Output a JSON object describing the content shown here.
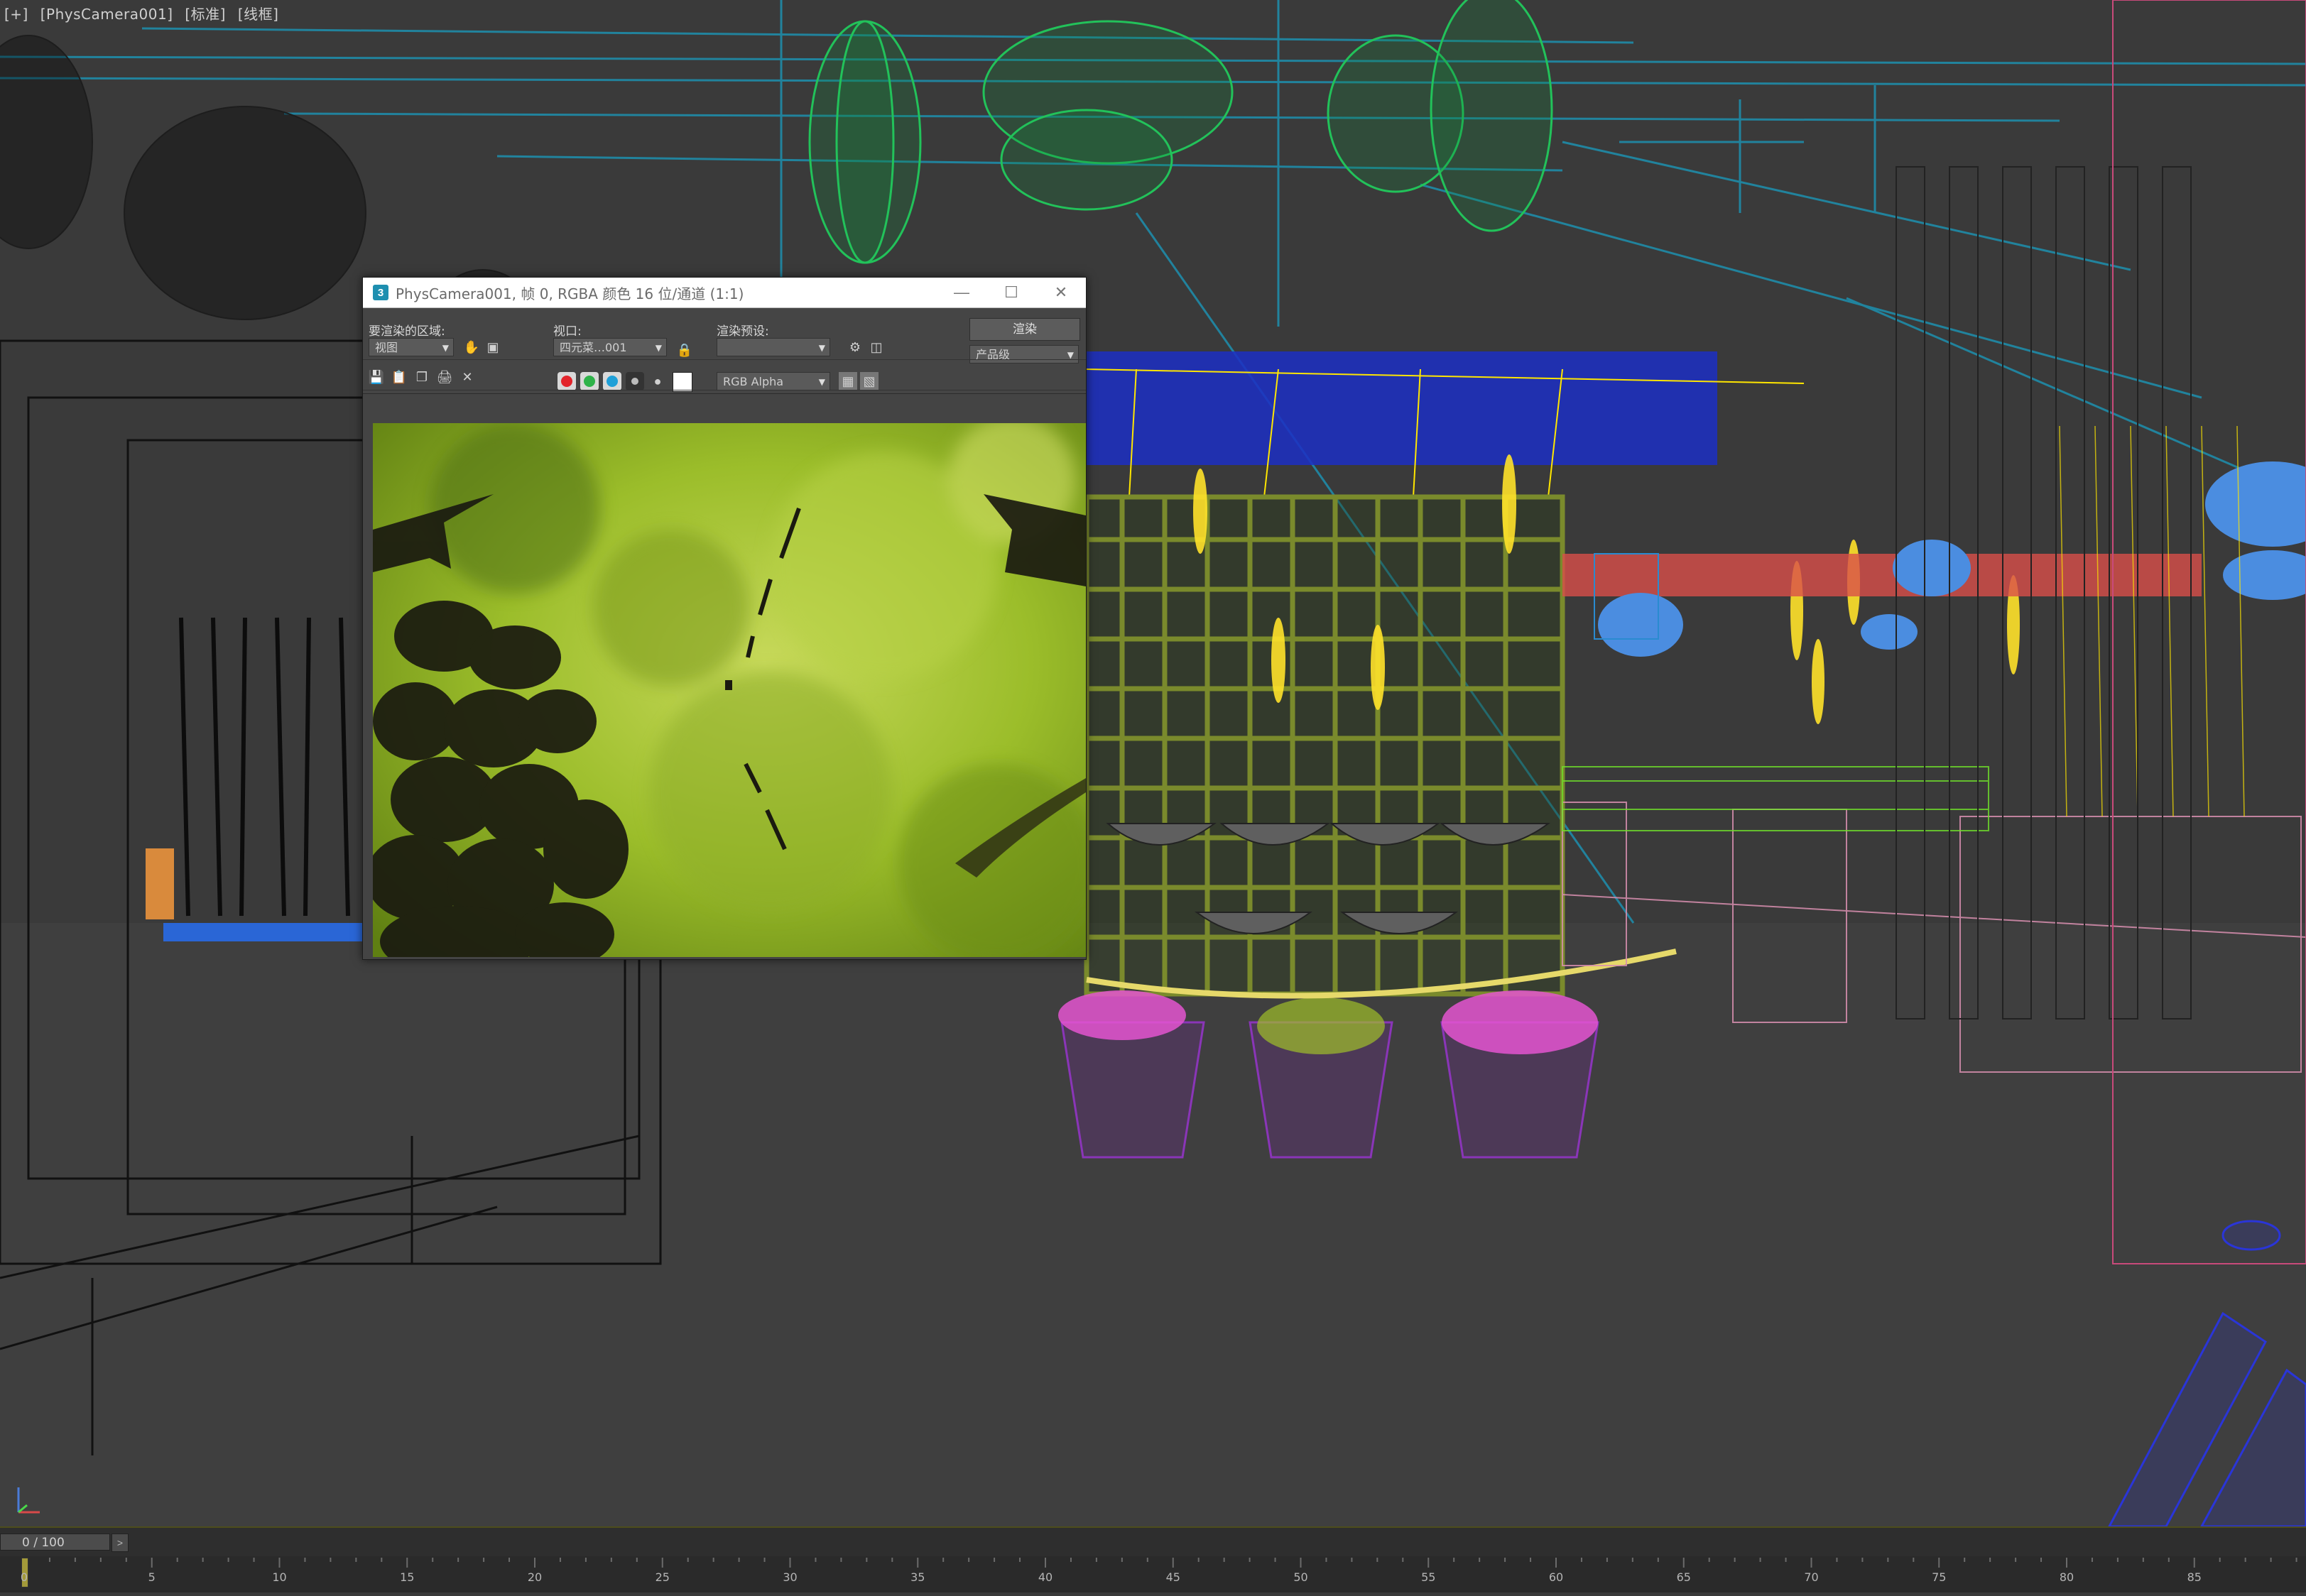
{
  "viewport": {
    "labels": [
      "[+]",
      "[PhysCamera001]",
      "[标准]",
      "[线框]"
    ]
  },
  "render_window": {
    "title": "PhysCamera001, 帧 0, RGBA 颜色 16 位/通道 (1:1)",
    "area_label": "要渲染的区域:",
    "area_value": "视图",
    "viewport_label": "视口:",
    "viewport_value": "四元菜…001",
    "preset_label": "渲染预设:",
    "preset_value": "",
    "render_button": "渲染",
    "quality_value": "产品级",
    "channel_value": "RGB Alpha",
    "channel_colors": {
      "red": "#e3242b",
      "green": "#2fb34a",
      "blue": "#1fa0d8"
    }
  },
  "timeline": {
    "slider_value": "0 / 100",
    "ticks": [
      "0",
      "5",
      "10",
      "15",
      "20",
      "25",
      "30",
      "35",
      "40",
      "45",
      "50",
      "55",
      "60",
      "65",
      "70",
      "75",
      "80",
      "85"
    ]
  }
}
